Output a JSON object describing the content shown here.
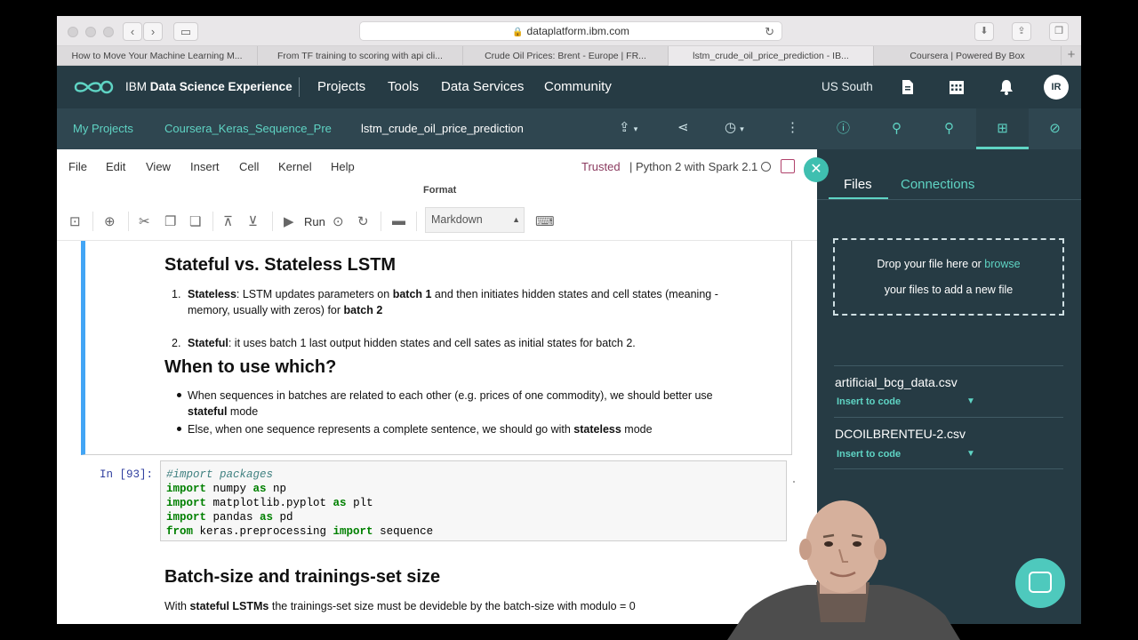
{
  "browser": {
    "url": "dataplatform.ibm.com",
    "tabs": [
      "How to Move Your Machine Learning M...",
      "From TF training to scoring with api cli...",
      "Crude Oil Prices: Brent - Europe | FR...",
      "lstm_crude_oil_price_prediction - IB...",
      "Coursera | Powered By Box"
    ],
    "new_tab": "+"
  },
  "topbar": {
    "brand_light": "IBM ",
    "brand_bold": "Data Science Experience",
    "menu": [
      "Projects",
      "Tools",
      "Data Services",
      "Community"
    ],
    "region": "US South",
    "avatar": "IR"
  },
  "breadcrumb": {
    "items": [
      "My Projects",
      "Coursera_Keras_Sequence_Prec",
      "lstm_crude_oil_price_prediction"
    ]
  },
  "notebook": {
    "menu": [
      "File",
      "Edit",
      "View",
      "Insert",
      "Cell",
      "Kernel",
      "Help"
    ],
    "trusted": "Trusted",
    "kernel": "| Python 2 with Spark 2.1",
    "format_label": "Format",
    "run_label": "Run",
    "cell_type": "Markdown",
    "md": {
      "h1": "Stateful vs. Stateless LSTM",
      "list1": [
        {
          "num": "1.",
          "b1": "Stateless",
          "t1": ": LSTM updates parameters on ",
          "b2": "batch 1",
          "t2": " and then initiates hidden states and cell states (meaning -",
          "line2a": "memory, usually with zeros) for ",
          "line2b": "batch 2"
        },
        {
          "num": "2.",
          "b1": "Stateful",
          "t1": ": it uses batch 1 last output hidden states and cell sates as initial states for batch 2."
        }
      ],
      "h2": "When to use which?",
      "bullets": [
        {
          "t1": "When sequences in batches are related to each other (e.g. prices of one commodity), we should better use",
          "b1": "stateful",
          "t2": " mode"
        },
        {
          "t1": "Else, when one sequence represents a complete sentence, we should go with ",
          "b1": "stateless",
          "t2": " mode"
        }
      ]
    },
    "code": {
      "prompt": "In [93]:",
      "lines": [
        {
          "comment": "#import packages"
        },
        {
          "kw1": "import",
          "t1": " numpy ",
          "kw2": "as",
          "t2": " np"
        },
        {
          "kw1": "import",
          "t1": " matplotlib.pyplot ",
          "kw2": "as",
          "t2": " plt"
        },
        {
          "kw1": "import",
          "t1": " pandas ",
          "kw2": "as",
          "t2": " pd"
        },
        {
          "kw1": "from",
          "t1": " keras.preprocessing ",
          "kw2": "import",
          "t2": " sequence"
        }
      ]
    },
    "md2": {
      "h": "Batch-size and trainings-set size",
      "t1": "With ",
      "b1": "stateful LSTMs",
      "t2": " the trainings-set size must be devideble by the batch-size with modulo = 0"
    }
  },
  "panel": {
    "tabs": [
      "Files",
      "Connections"
    ],
    "drop_text": "Drop your file here or ",
    "drop_link": "browse",
    "drop_text2": "your files to add a new file",
    "files": [
      {
        "name": "artificial_bcg_data.csv",
        "action": "Insert to code"
      },
      {
        "name": "DCOILBRENTEU-2.csv",
        "action": "Insert to code"
      }
    ]
  },
  "colors": {
    "topbar": "#263b44",
    "accent": "#5fd4c4",
    "cell_selected": "#42a5f5"
  }
}
